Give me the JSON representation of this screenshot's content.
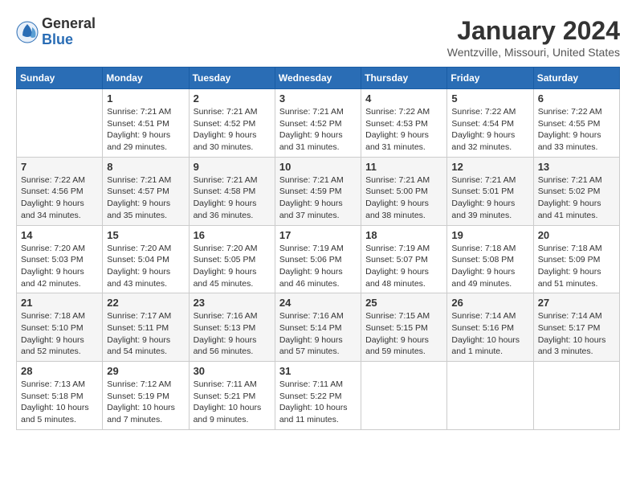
{
  "header": {
    "logo_general": "General",
    "logo_blue": "Blue",
    "month_title": "January 2024",
    "location": "Wentzville, Missouri, United States"
  },
  "weekdays": [
    "Sunday",
    "Monday",
    "Tuesday",
    "Wednesday",
    "Thursday",
    "Friday",
    "Saturday"
  ],
  "weeks": [
    [
      null,
      {
        "day": 1,
        "sunrise": "7:21 AM",
        "sunset": "4:51 PM",
        "daylight": "9 hours and 29 minutes."
      },
      {
        "day": 2,
        "sunrise": "7:21 AM",
        "sunset": "4:52 PM",
        "daylight": "9 hours and 30 minutes."
      },
      {
        "day": 3,
        "sunrise": "7:21 AM",
        "sunset": "4:52 PM",
        "daylight": "9 hours and 31 minutes."
      },
      {
        "day": 4,
        "sunrise": "7:22 AM",
        "sunset": "4:53 PM",
        "daylight": "9 hours and 31 minutes."
      },
      {
        "day": 5,
        "sunrise": "7:22 AM",
        "sunset": "4:54 PM",
        "daylight": "9 hours and 32 minutes."
      },
      {
        "day": 6,
        "sunrise": "7:22 AM",
        "sunset": "4:55 PM",
        "daylight": "9 hours and 33 minutes."
      }
    ],
    [
      {
        "day": 7,
        "sunrise": "7:22 AM",
        "sunset": "4:56 PM",
        "daylight": "9 hours and 34 minutes."
      },
      {
        "day": 8,
        "sunrise": "7:21 AM",
        "sunset": "4:57 PM",
        "daylight": "9 hours and 35 minutes."
      },
      {
        "day": 9,
        "sunrise": "7:21 AM",
        "sunset": "4:58 PM",
        "daylight": "9 hours and 36 minutes."
      },
      {
        "day": 10,
        "sunrise": "7:21 AM",
        "sunset": "4:59 PM",
        "daylight": "9 hours and 37 minutes."
      },
      {
        "day": 11,
        "sunrise": "7:21 AM",
        "sunset": "5:00 PM",
        "daylight": "9 hours and 38 minutes."
      },
      {
        "day": 12,
        "sunrise": "7:21 AM",
        "sunset": "5:01 PM",
        "daylight": "9 hours and 39 minutes."
      },
      {
        "day": 13,
        "sunrise": "7:21 AM",
        "sunset": "5:02 PM",
        "daylight": "9 hours and 41 minutes."
      }
    ],
    [
      {
        "day": 14,
        "sunrise": "7:20 AM",
        "sunset": "5:03 PM",
        "daylight": "9 hours and 42 minutes."
      },
      {
        "day": 15,
        "sunrise": "7:20 AM",
        "sunset": "5:04 PM",
        "daylight": "9 hours and 43 minutes."
      },
      {
        "day": 16,
        "sunrise": "7:20 AM",
        "sunset": "5:05 PM",
        "daylight": "9 hours and 45 minutes."
      },
      {
        "day": 17,
        "sunrise": "7:19 AM",
        "sunset": "5:06 PM",
        "daylight": "9 hours and 46 minutes."
      },
      {
        "day": 18,
        "sunrise": "7:19 AM",
        "sunset": "5:07 PM",
        "daylight": "9 hours and 48 minutes."
      },
      {
        "day": 19,
        "sunrise": "7:18 AM",
        "sunset": "5:08 PM",
        "daylight": "9 hours and 49 minutes."
      },
      {
        "day": 20,
        "sunrise": "7:18 AM",
        "sunset": "5:09 PM",
        "daylight": "9 hours and 51 minutes."
      }
    ],
    [
      {
        "day": 21,
        "sunrise": "7:18 AM",
        "sunset": "5:10 PM",
        "daylight": "9 hours and 52 minutes."
      },
      {
        "day": 22,
        "sunrise": "7:17 AM",
        "sunset": "5:11 PM",
        "daylight": "9 hours and 54 minutes."
      },
      {
        "day": 23,
        "sunrise": "7:16 AM",
        "sunset": "5:13 PM",
        "daylight": "9 hours and 56 minutes."
      },
      {
        "day": 24,
        "sunrise": "7:16 AM",
        "sunset": "5:14 PM",
        "daylight": "9 hours and 57 minutes."
      },
      {
        "day": 25,
        "sunrise": "7:15 AM",
        "sunset": "5:15 PM",
        "daylight": "9 hours and 59 minutes."
      },
      {
        "day": 26,
        "sunrise": "7:14 AM",
        "sunset": "5:16 PM",
        "daylight": "10 hours and 1 minute."
      },
      {
        "day": 27,
        "sunrise": "7:14 AM",
        "sunset": "5:17 PM",
        "daylight": "10 hours and 3 minutes."
      }
    ],
    [
      {
        "day": 28,
        "sunrise": "7:13 AM",
        "sunset": "5:18 PM",
        "daylight": "10 hours and 5 minutes."
      },
      {
        "day": 29,
        "sunrise": "7:12 AM",
        "sunset": "5:19 PM",
        "daylight": "10 hours and 7 minutes."
      },
      {
        "day": 30,
        "sunrise": "7:11 AM",
        "sunset": "5:21 PM",
        "daylight": "10 hours and 9 minutes."
      },
      {
        "day": 31,
        "sunrise": "7:11 AM",
        "sunset": "5:22 PM",
        "daylight": "10 hours and 11 minutes."
      },
      null,
      null,
      null
    ]
  ]
}
